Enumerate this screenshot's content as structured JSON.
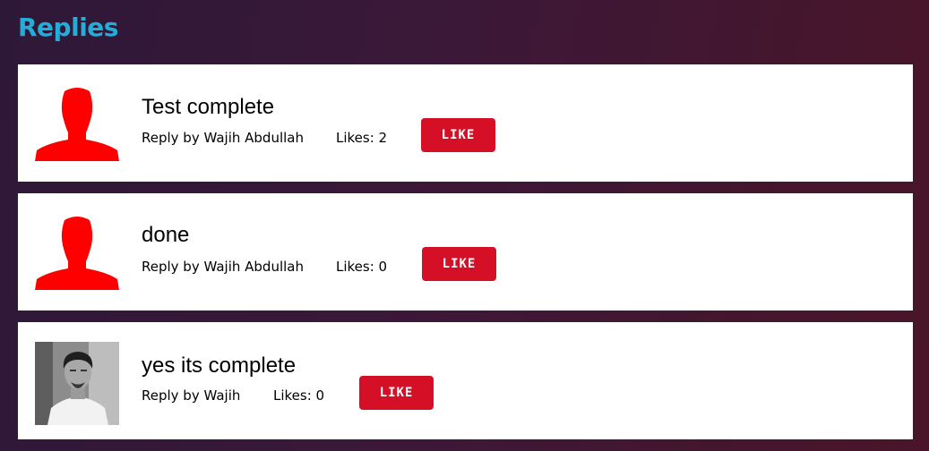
{
  "page": {
    "title": "Replies"
  },
  "replies": [
    {
      "text": "Test complete",
      "author_line": "Reply by Wajih Abdullah",
      "likes_line": "Likes: 2",
      "like_label": "LIKE",
      "avatar": "user-silhouette-icon"
    },
    {
      "text": "done",
      "author_line": "Reply by Wajih Abdullah",
      "likes_line": "Likes: 0",
      "like_label": "LIKE",
      "avatar": "user-silhouette-icon"
    },
    {
      "text": "yes its complete",
      "author_line": "Reply by Wajih",
      "likes_line": "Likes: 0",
      "like_label": "LIKE",
      "avatar": "profile-photo"
    }
  ],
  "colors": {
    "title": "#22aed8",
    "like_button": "#d50f25",
    "avatar_icon": "#ff0000",
    "card_background": "#ffffff"
  }
}
